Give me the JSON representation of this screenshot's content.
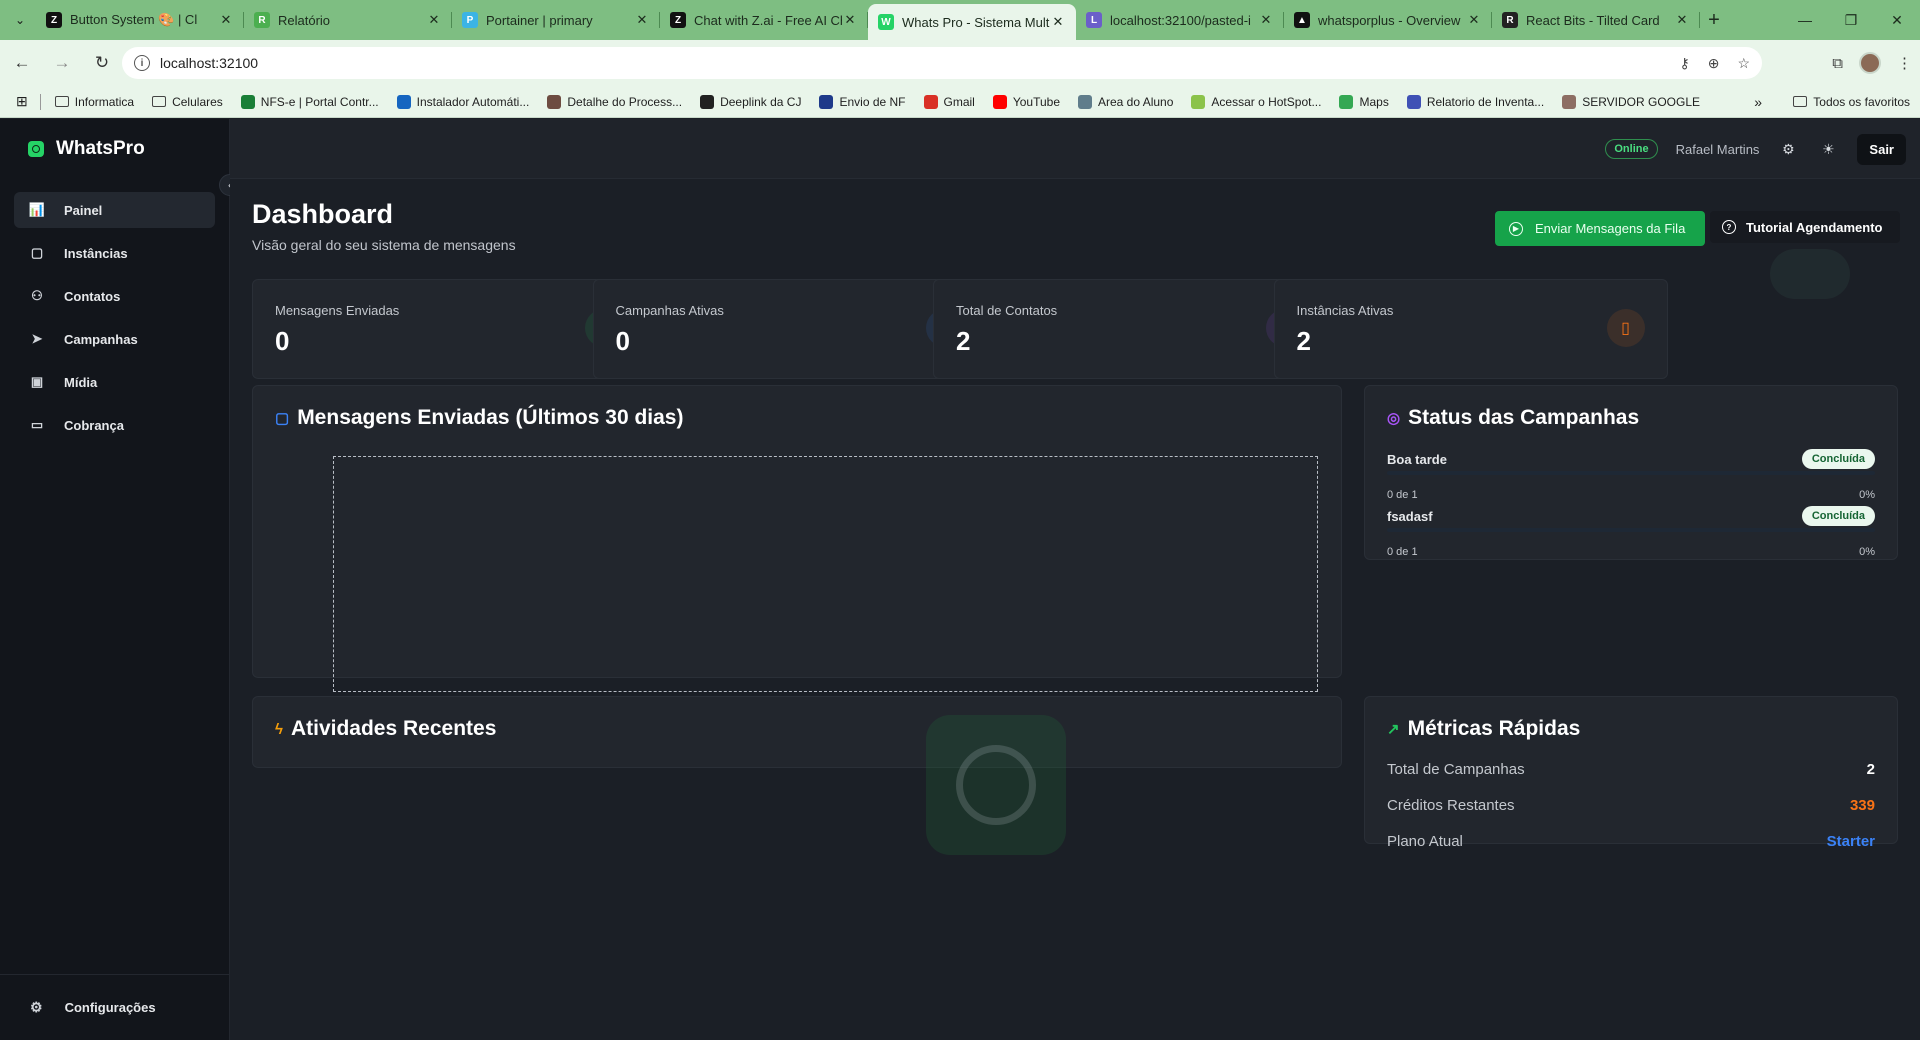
{
  "browser": {
    "tabs": [
      {
        "title": "Button System 🎨 | Cl",
        "icon": "z-icon",
        "color": "#111111",
        "glyph": "Z"
      },
      {
        "title": "Relatório",
        "icon": "report-icon",
        "color": "#4caf50",
        "glyph": "R"
      },
      {
        "title": "Portainer | primary",
        "icon": "portainer-icon",
        "color": "#3bb4e5",
        "glyph": "P"
      },
      {
        "title": "Chat with Z.ai - Free AI Ch",
        "icon": "z-icon",
        "color": "#111111",
        "glyph": "Z"
      },
      {
        "title": "Whats Pro - Sistema Mult",
        "icon": "whatsapp-icon",
        "color": "#25d366",
        "glyph": "W",
        "active": true
      },
      {
        "title": "localhost:32100/pasted-i",
        "icon": "globe-icon",
        "color": "#6b5fc9",
        "glyph": "L"
      },
      {
        "title": "whatsporplus - Overview",
        "icon": "triangle-icon",
        "color": "#111111",
        "glyph": "▲"
      },
      {
        "title": "React Bits - Tilted Card",
        "icon": "react-icon",
        "color": "#222222",
        "glyph": "R"
      }
    ],
    "url": "localhost:32100",
    "bookmarks": [
      {
        "label": "Informatica",
        "type": "folder"
      },
      {
        "label": "Celulares",
        "type": "folder"
      },
      {
        "label": "NFS-e | Portal Contr...",
        "type": "site",
        "color": "#1a7f37"
      },
      {
        "label": "Instalador Automáti...",
        "type": "site",
        "color": "#1565c0"
      },
      {
        "label": "Detalhe do Process...",
        "type": "site",
        "color": "#6d4c41"
      },
      {
        "label": "Deeplink da CJ",
        "type": "site",
        "color": "#212121"
      },
      {
        "label": "Envio de NF",
        "type": "site",
        "color": "#1e3a8a"
      },
      {
        "label": "Gmail",
        "type": "site",
        "color": "#d93025"
      },
      {
        "label": "YouTube",
        "type": "site",
        "color": "#ff0000"
      },
      {
        "label": "Area do Aluno",
        "type": "site",
        "color": "#607d8b"
      },
      {
        "label": "Acessar o HotSpot...",
        "type": "site",
        "color": "#8bc34a"
      },
      {
        "label": "Maps",
        "type": "site",
        "color": "#34a853"
      },
      {
        "label": "Relatorio de Inventa...",
        "type": "site",
        "color": "#3f51b5"
      },
      {
        "label": "SERVIDOR GOOGLE",
        "type": "site",
        "color": "#8d6e63"
      }
    ],
    "bookmarks_more": "»",
    "all_bookmarks": "Todos os favoritos"
  },
  "app": {
    "brand": "WhatsPro",
    "menu": [
      {
        "label": "Painel",
        "icon": "bar-chart-icon",
        "glyph": "📊",
        "active": true
      },
      {
        "label": "Instâncias",
        "icon": "message-square-icon",
        "glyph": "▢"
      },
      {
        "label": "Contatos",
        "icon": "users-icon",
        "glyph": "⚇"
      },
      {
        "label": "Campanhas",
        "icon": "send-icon",
        "glyph": "➤"
      },
      {
        "label": "Mídia",
        "icon": "image-icon",
        "glyph": "▣"
      },
      {
        "label": "Cobrança",
        "icon": "credit-card-icon",
        "glyph": "▭"
      }
    ],
    "settings_label": "Configurações",
    "topbar": {
      "status": "Online",
      "user": "Rafael Martins",
      "logout": "Sair"
    },
    "page": {
      "title": "Dashboard",
      "subtitle": "Visão geral do seu sistema de mensagens",
      "send_queue_button": "Enviar Mensagens da Fila",
      "tutorial_button": "Tutorial Agendamento"
    },
    "stats": [
      {
        "label": "Mensagens Enviadas",
        "value": "0",
        "icon": "send-icon",
        "color": "#22c55e"
      },
      {
        "label": "Campanhas Ativas",
        "value": "0",
        "icon": "message-square-icon",
        "color": "#3b82f6"
      },
      {
        "label": "Total de Contatos",
        "value": "2",
        "icon": "users-icon",
        "color": "#a855f7"
      },
      {
        "label": "Instâncias Ativas",
        "value": "2",
        "icon": "smartphone-icon",
        "color": "#f97316"
      }
    ],
    "messages_chart": {
      "title": "Mensagens Enviadas (Últimos 30 dias)"
    },
    "campaign_status": {
      "title": "Status das Campanhas",
      "items": [
        {
          "name": "Boa tarde",
          "status": "Concluída",
          "progress_text": "0 de 1",
          "percent": "0%"
        },
        {
          "name": "fsadasf",
          "status": "Concluída",
          "progress_text": "0 de 1",
          "percent": "0%"
        }
      ]
    },
    "recent_activity": {
      "title": "Atividades Recentes"
    },
    "quick_metrics": {
      "title": "Métricas Rápidas",
      "rows": [
        {
          "label": "Total de Campanhas",
          "value": "2",
          "color": "#ffffff"
        },
        {
          "label": "Créditos Restantes",
          "value": "339",
          "color": "#f97316"
        },
        {
          "label": "Plano Atual",
          "value": "Starter",
          "color": "#3b82f6"
        }
      ]
    }
  }
}
